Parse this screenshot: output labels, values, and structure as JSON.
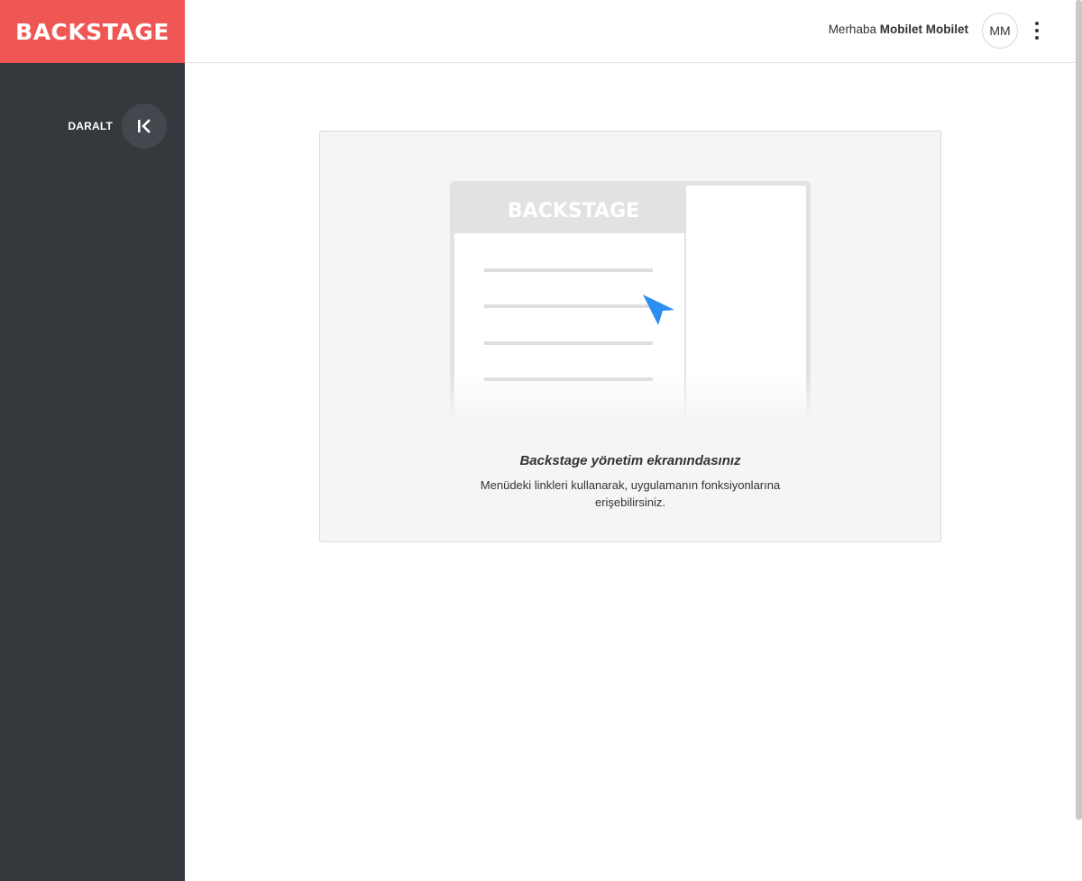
{
  "brand": {
    "logo_text": "BACKSTAGE",
    "color": "#ee5754"
  },
  "sidebar": {
    "background": "#35383d",
    "collapse_label": "DARALT",
    "collapse_icon": "collapse-left-icon"
  },
  "header": {
    "greeting_prefix": "Merhaba",
    "user_name": "Mobilet Mobilet",
    "avatar_initials": "MM",
    "menu_icon": "more-vertical-icon"
  },
  "welcome": {
    "illustration_logo": "BACKSTAGE",
    "title": "Backstage yönetim ekranındasınız",
    "description": "Menüdeki linkleri kullanarak, uygulamanın fonksiyonlarına erişebilirsiniz.",
    "cursor_color": "#2b8ef0"
  }
}
